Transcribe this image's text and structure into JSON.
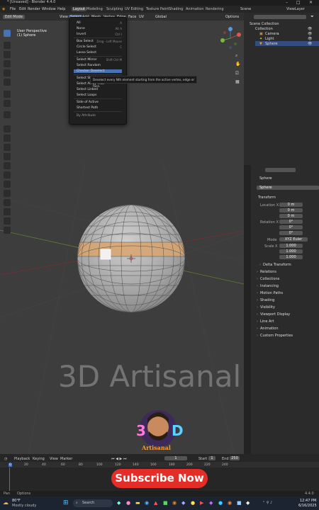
{
  "window": {
    "title": "* [Unsaved] - Blender 4.4.0"
  },
  "menubar": {
    "items": [
      "File",
      "Edit",
      "Render",
      "Window",
      "Help"
    ],
    "workspace_tabs": [
      "Layout",
      "Modeling",
      "Sculpting",
      "UV Editing",
      "Texture Paint",
      "Shading",
      "Animation",
      "Rendering"
    ],
    "active_tab": "Layout",
    "scene_label": "Scene",
    "view_layer_label": "ViewLayer"
  },
  "viewport_header": {
    "mode": "Edit Mode",
    "menus": [
      "View",
      "Select",
      "Add",
      "Mesh",
      "Vertex",
      "Edge",
      "Face",
      "UV"
    ],
    "transform_orientation": "Global",
    "options_label": "Options"
  },
  "viewport": {
    "view_name": "User Perspective",
    "object_name": "(1) Sphere",
    "watermark": "3D Artisanal",
    "logo_text": "Artisanal"
  },
  "select_menu": {
    "items": [
      {
        "label": "All",
        "shortcut": "A"
      },
      {
        "label": "None",
        "shortcut": "Alt A"
      },
      {
        "label": "Invert",
        "shortcut": "Ctrl I"
      },
      {
        "label": "Box Select",
        "shortcut": "Drag - Left Mouse"
      },
      {
        "label": "Circle Select",
        "shortcut": "C"
      },
      {
        "label": "Lasso Select",
        "shortcut": ""
      },
      {
        "label": "Select Mirror",
        "shortcut": "Shift Ctrl M"
      },
      {
        "label": "Select Random",
        "shortcut": ""
      },
      {
        "label": "Checker Deselect",
        "shortcut": ""
      },
      {
        "label": "Select Sharp Edges",
        "shortcut": ""
      },
      {
        "label": "Select All by Trait",
        "shortcut": ""
      },
      {
        "label": "Select Linked",
        "shortcut": ""
      },
      {
        "label": "Select Loops",
        "shortcut": ""
      },
      {
        "label": "Side of Active",
        "shortcut": ""
      },
      {
        "label": "Shortest Path",
        "shortcut": ""
      },
      {
        "label": "By Attribute",
        "shortcut": ""
      }
    ],
    "tooltip": "Deselect every Nth element starting from the active vertex, edge or face."
  },
  "outliner": {
    "search_placeholder": "",
    "scene_collection": "Scene Collection",
    "collection": "Collection",
    "objects": [
      "Camera",
      "Light",
      "Sphere"
    ]
  },
  "properties": {
    "object_name": "Sphere",
    "transform_header": "Transform",
    "location_label": "Location X",
    "location": [
      "0 m",
      "0 m",
      "0 m"
    ],
    "rotation_label": "Rotation X",
    "rotation": [
      "0°",
      "0°",
      "0°"
    ],
    "mode_label": "Mode",
    "mode_value": "XYZ Euler",
    "scale_label": "Scale X",
    "scale": [
      "1.000",
      "1.000",
      "1.000"
    ],
    "delta_transform": "Delta Transform",
    "sections": [
      "Relations",
      "Collections",
      "Instancing",
      "Motion Paths",
      "Shading",
      "Visibility",
      "Viewport Display",
      "Line Art",
      "Animation",
      "Custom Properties"
    ]
  },
  "timeline": {
    "menus": [
      "Playback",
      "Keying",
      "View",
      "Marker"
    ],
    "current_frame": "1",
    "start_label": "Start",
    "start_value": "1",
    "end_label": "End",
    "end_value": "250",
    "ruler": [
      "0",
      "20",
      "40",
      "60",
      "80",
      "100",
      "120",
      "140",
      "160",
      "180",
      "200",
      "220",
      "240"
    ]
  },
  "subscribe": {
    "label": "Subscribe Now"
  },
  "statusbar": {
    "left": "Pan",
    "right": "Options",
    "version": "4.4.0"
  },
  "taskbar": {
    "weather_temp": "80°F",
    "weather_desc": "Mostly cloudy",
    "search_placeholder": "Search",
    "time": "12:47 PM",
    "date": "6/16/2025"
  }
}
